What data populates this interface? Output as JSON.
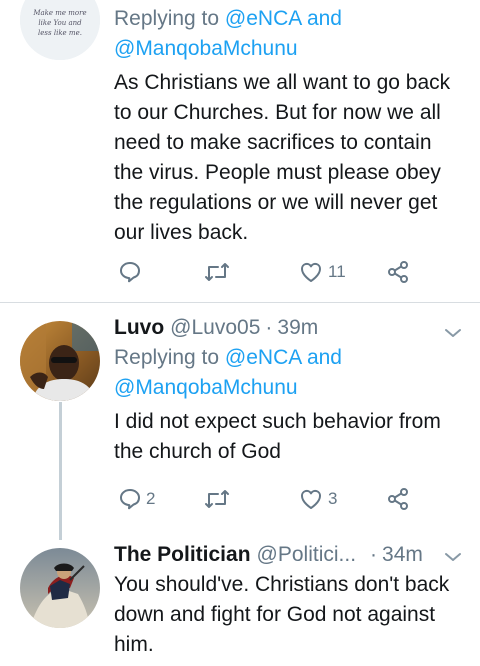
{
  "tweets": [
    {
      "replying_prefix": "Replying to",
      "mentions": [
        "@eNCA",
        "@ManqobaMchunu"
      ],
      "mention_joiner": "and",
      "text": "As Christians we all want to go back to our Churches. But for now we all need to make sacrifices to contain the virus. People must please obey the regulations or we will never get our lives back.",
      "reply_count": "",
      "retweet_count": "",
      "like_count": "11",
      "avatar_art_text": "Make me more like You and less like me."
    },
    {
      "name": "Luvo",
      "handle": "@Luvo05",
      "separator": "·",
      "time": "39m",
      "replying_prefix": "Replying to",
      "mentions": [
        "@eNCA",
        "@ManqobaMchunu"
      ],
      "mention_joiner": "and",
      "text": "I did not expect such behavior from the church of God",
      "reply_count": "2",
      "retweet_count": "",
      "like_count": "3"
    },
    {
      "name": "The Politician",
      "handle": "@Politici...",
      "separator": "·",
      "time": "34m",
      "text": "You should've. Christians don't back down and fight for God not against him."
    }
  ],
  "icons": {
    "reply": "reply-icon",
    "retweet": "retweet-icon",
    "like": "heart-icon",
    "share": "share-icon",
    "menu": "chevron-down-icon"
  },
  "colors": {
    "link": "#1da1f2",
    "muted": "#657786",
    "text": "#14171a",
    "divider": "#d8dde1"
  }
}
